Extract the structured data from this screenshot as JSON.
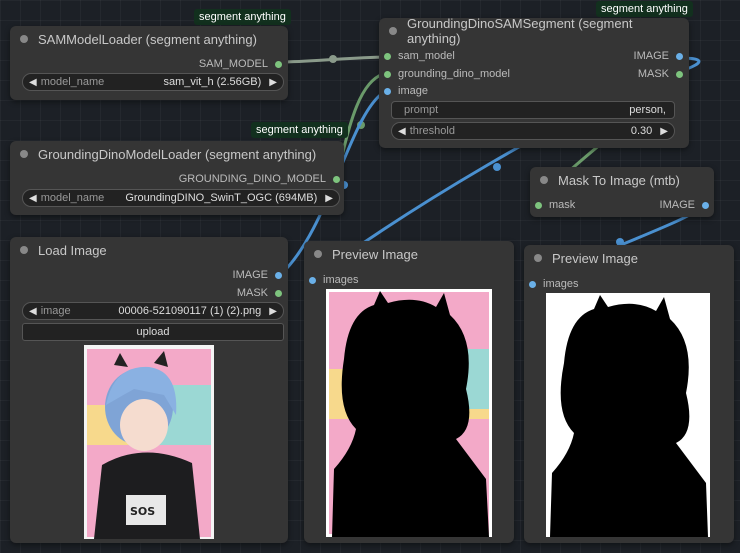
{
  "colors": {
    "canvas": "#1c2026",
    "node_bg": "#353535",
    "badge_bg": "#12301e",
    "dot_green": "#7ec47e",
    "dot_blue": "#6ab0e8",
    "wire_blue": "#4a90d0",
    "wire_green": "#6a9a6a",
    "wire_gray": "#8a9a8a"
  },
  "badges": {
    "sam_loader": "segment anything",
    "dino_segment": "segment anything",
    "dino_loader": "segment anything"
  },
  "sam_loader": {
    "title": "SAMModelLoader (segment anything)",
    "output_label": "SAM_MODEL",
    "widget": {
      "name": "model_name",
      "value": "sam_vit_h (2.56GB)"
    }
  },
  "dino_segment": {
    "title": "GroundingDinoSAMSegment (segment anything)",
    "inputs": [
      "sam_model",
      "grounding_dino_model",
      "image"
    ],
    "outputs": [
      "IMAGE",
      "MASK"
    ],
    "prompt": {
      "name": "prompt",
      "value": "person,"
    },
    "threshold": {
      "name": "threshold",
      "value": "0.30"
    }
  },
  "dino_loader": {
    "title": "GroundingDinoModelLoader (segment anything)",
    "output_label": "GROUNDING_DINO_MODEL",
    "widget": {
      "name": "model_name",
      "value": "GroundingDINO_SwinT_OGC (694MB)"
    }
  },
  "mask_to_image": {
    "title": "Mask To Image (mtb)",
    "input_label": "mask",
    "output_label": "IMAGE"
  },
  "load_image": {
    "title": "Load Image",
    "outputs": [
      "IMAGE",
      "MASK"
    ],
    "widget": {
      "name": "image",
      "value": "00006-521090117 (1) (2).png"
    },
    "upload_label": "upload"
  },
  "preview1": {
    "title": "Preview Image",
    "input_label": "images"
  },
  "preview2": {
    "title": "Preview Image",
    "input_label": "images"
  }
}
